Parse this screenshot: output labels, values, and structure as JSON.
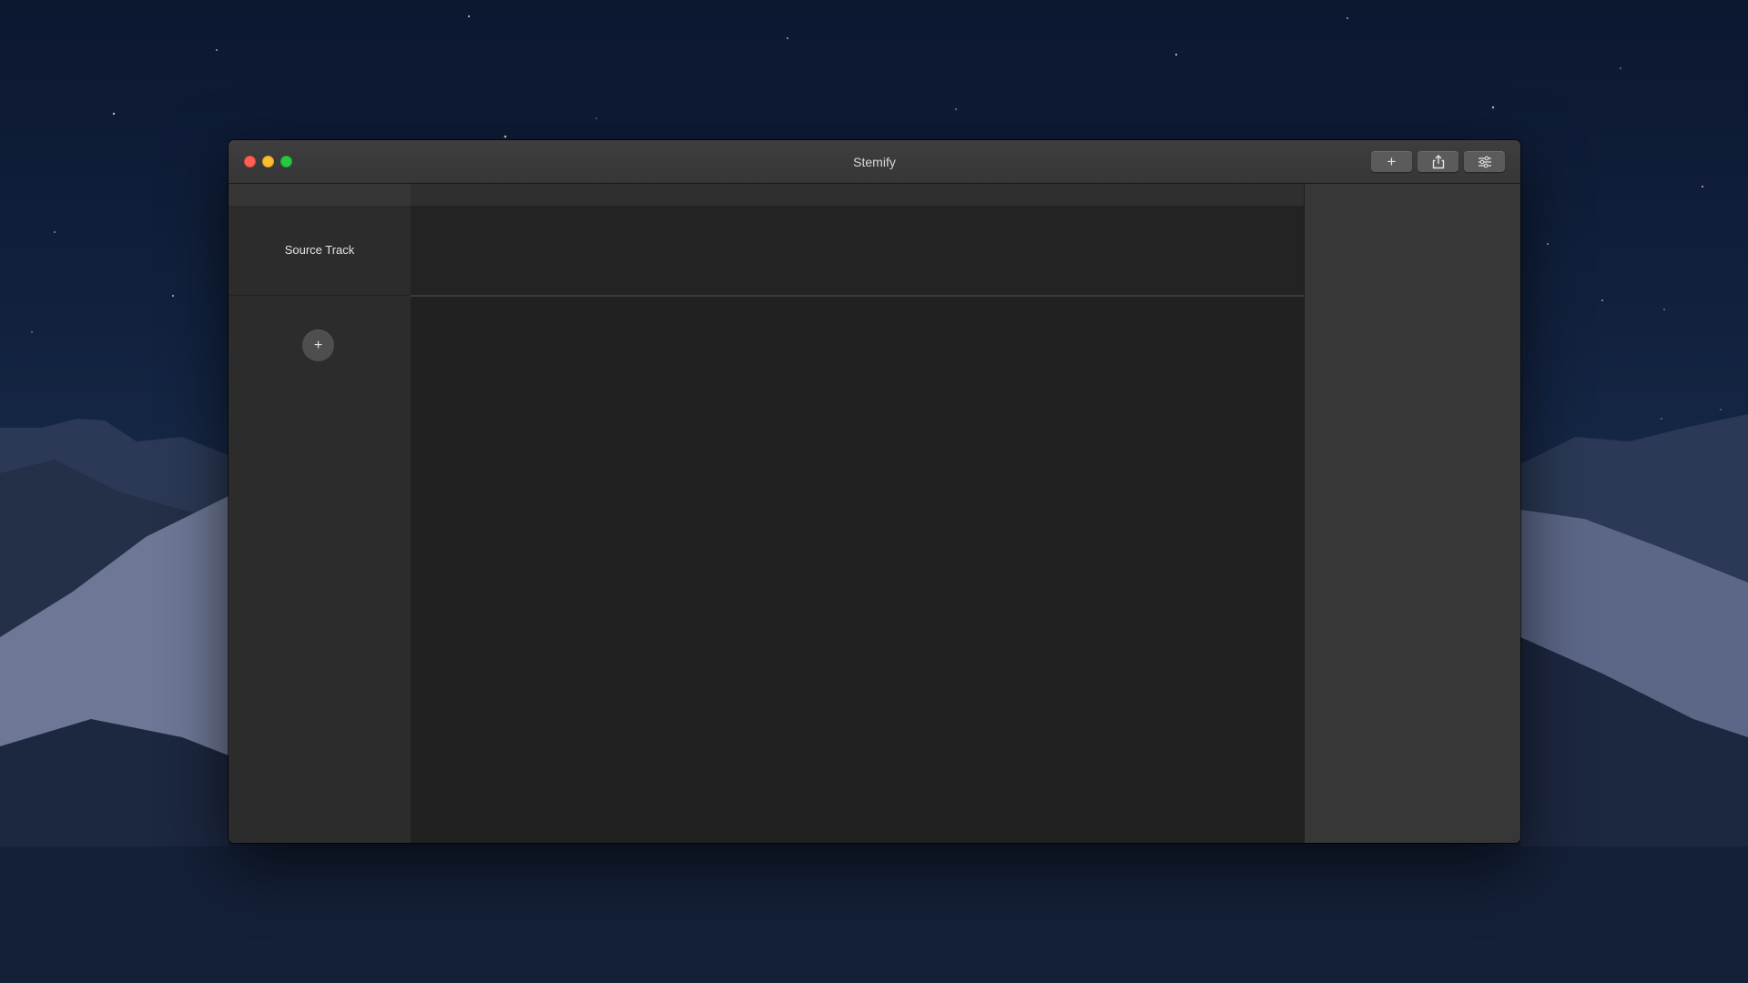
{
  "window": {
    "title": "Stemify"
  },
  "toolbar": {
    "add_label": "+",
    "share_icon": "share-icon",
    "settings_icon": "sliders-icon"
  },
  "tracks": {
    "source_label": "Source Track",
    "add_stem_label": "+"
  },
  "colors": {
    "close": "#fe5f57",
    "minimize": "#febc2e",
    "zoom": "#28c840",
    "window_bg": "#2c2c2c",
    "lane_bg": "#212121",
    "sidebar_bg": "#373737"
  }
}
